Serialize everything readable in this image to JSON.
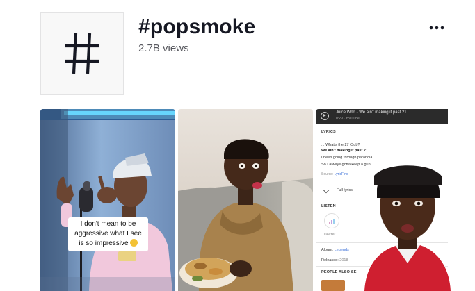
{
  "header": {
    "title": "#popsmoke",
    "views": "2.7B views",
    "more_icon": "ellipsis-horizontal-icon",
    "tag_icon": "hashtag-icon"
  },
  "videos": [
    {
      "caption_line1": "I don't mean to be",
      "caption_line2": "aggressive what I see",
      "caption_line3": "is so impressive"
    },
    {},
    {
      "bar_title": "Juice Wrld - We ain't making it past 21",
      "bar_sub": "0:29 · YouTube",
      "lyrics_header": "LYRICS",
      "lyric1": "... What's the 27 Club?",
      "lyric2": "We ain't making it past 21",
      "lyric3": "I been going through paranoia",
      "lyric4": "So I always gotta keep a gun...",
      "source_prefix": "Source: ",
      "source_link": "LyricFind",
      "full_lyrics": "Full lyrics",
      "listen_header": "LISTEN",
      "deezer_label": "Deezer",
      "album_prefix": "Album: ",
      "album_value": "Legends",
      "released_prefix": "Released: ",
      "released_value": "2018",
      "people_header": "PEOPLE ALSO SE"
    }
  ],
  "colors": {
    "title": "#161823",
    "subtext": "#57585e",
    "neon": "#54d3ff",
    "link": "#3a6fd8"
  }
}
